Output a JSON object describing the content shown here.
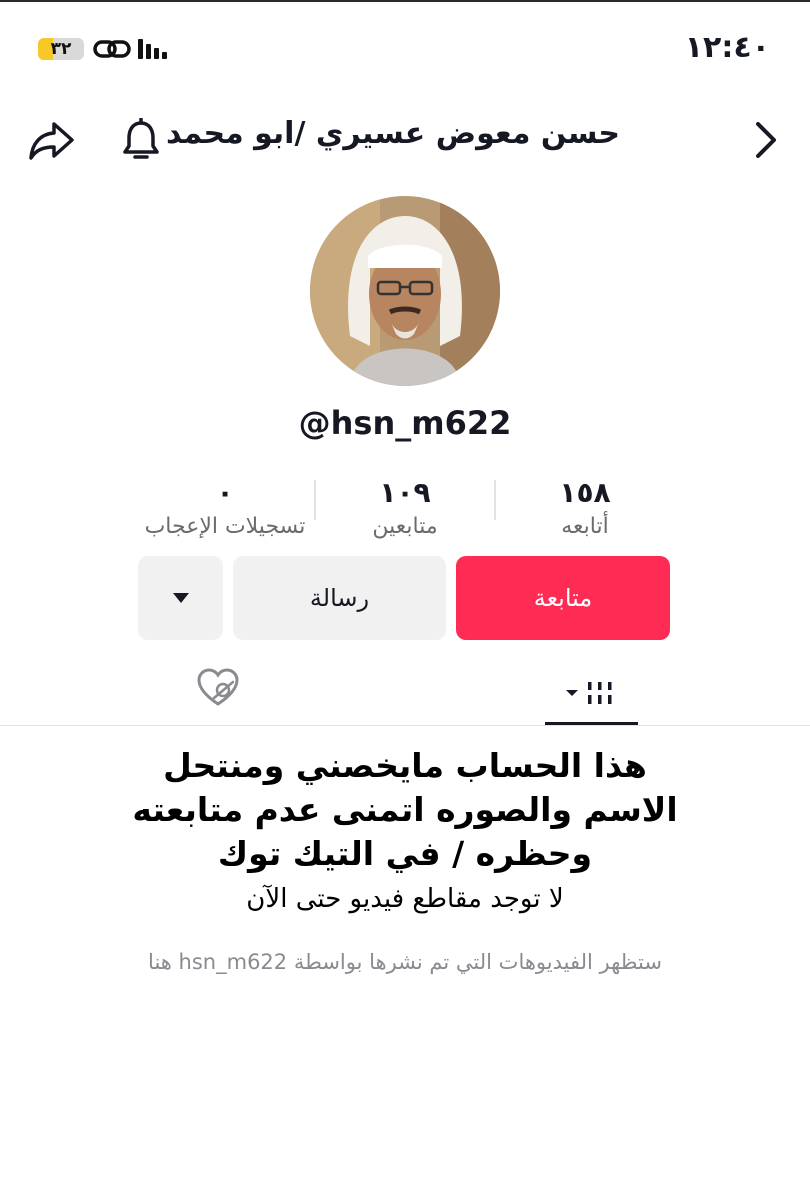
{
  "status_bar": {
    "time": "١٢:٤٠",
    "battery_level": "٣٢",
    "battery_fraction": 0.32
  },
  "header": {
    "title": "حسن معوض عسيري /ابو محمد",
    "icons": [
      "back-chevron-icon",
      "bell-icon",
      "share-icon"
    ]
  },
  "profile": {
    "username": "@hsn_m622"
  },
  "stats": {
    "following": {
      "value": "١٥٨",
      "label": "أتابعه"
    },
    "followers": {
      "value": "١٠٩",
      "label": "متابعين"
    },
    "likes": {
      "value": "٠",
      "label": "تسجيلات الإعجاب"
    }
  },
  "actions": {
    "follow": "متابعة",
    "message": "رسالة",
    "more_icon": "dropdown-caret-icon"
  },
  "tabs": {
    "videos_icon": "videos-grid-icon",
    "liked_icon": "hidden-liked-icon"
  },
  "content": {
    "bio_lines": [
      "هذا الحساب مايخصني ومنتحل",
      "الاسم والصوره اتمنى عدم متابعته",
      "وحظره / في التيك توك"
    ],
    "no_videos": "لا توجد مقاطع فيديو حتى الآن",
    "hint": "ستظهر الفيديوهات التي تم نشرها بواسطة hsn_m622 هنا"
  },
  "colors": {
    "accent": "#fe2c55",
    "button_gray": "#f1f1f2",
    "text": "#161823",
    "muted": "#8a8b91"
  }
}
